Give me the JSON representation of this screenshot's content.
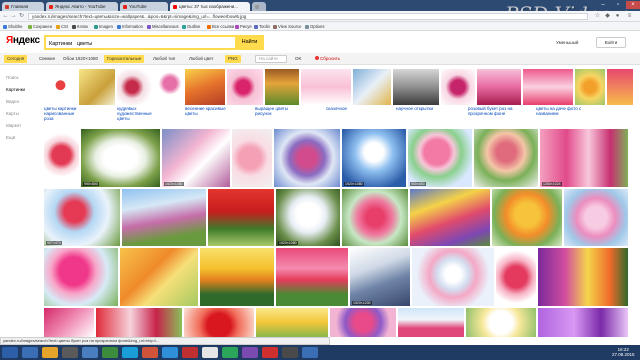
{
  "watermark": "PSD Video.ru",
  "tabs": [
    {
      "label": "Главная",
      "icon": "home-icon",
      "color": "#cf3a2a"
    },
    {
      "label": "Яндекс Авито - YouTube",
      "icon": "youtube-icon",
      "color": "#e62117"
    },
    {
      "label": "YouTube",
      "icon": "youtube-icon",
      "color": "#e62117"
    },
    {
      "label": "цветы: 37 тыс изображени...",
      "icon": "yandex-icon",
      "color": "#f00"
    },
    {
      "label": "",
      "icon": "new-tab-icon",
      "color": "#999"
    }
  ],
  "address": "yandex.ru/images/search?text=цветы&isize=wallpaper&...&pos=6&rpt=simage&img_url=...floweerbowl6.jpg",
  "bookmarks": [
    {
      "label": "Shubhe",
      "color": "#3a7bd5"
    },
    {
      "label": "Сохранен",
      "color": "#7bb341"
    },
    {
      "label": "CSI",
      "color": "#e6a117"
    },
    {
      "label": "Кэпок",
      "color": "#4a4a4a"
    },
    {
      "label": "Imagen",
      "color": "#2a9d8f"
    },
    {
      "label": "Information",
      "color": "#3a7bd5"
    },
    {
      "label": "Miscellaneous",
      "color": "#7e57c2"
    },
    {
      "label": "Outline",
      "color": "#26a69a"
    },
    {
      "label": "Все ссылки",
      "color": "#ef6c00"
    },
    {
      "label": "Рисуя",
      "color": "#ab47bc"
    },
    {
      "label": "Toolin",
      "color": "#5c6bc0"
    },
    {
      "label": "View Source",
      "color": "#8d6e63"
    },
    {
      "label": "Options",
      "color": "#78909c"
    }
  ],
  "logo": {
    "first": "Я",
    "rest": "ндекс"
  },
  "search": {
    "query": "Картинки   цветы",
    "button": "Найти"
  },
  "header_right": {
    "uploaded": "Уменьшый",
    "login": "Войти"
  },
  "filters": [
    {
      "label": "Сегодня",
      "style": "yellow"
    },
    {
      "label": "Свежие",
      "style": "plain"
    },
    {
      "label": "Обои 1920×1080",
      "style": "plain"
    },
    {
      "label": "Горизонтальные",
      "style": "yellow"
    },
    {
      "label": "Любой тип",
      "style": "plain"
    },
    {
      "label": "Любой цвет",
      "style": "plain"
    },
    {
      "label": "PNG",
      "style": "yellow"
    },
    {
      "label": "На сайте",
      "style": "box"
    },
    {
      "label": "OK",
      "style": "plain"
    },
    {
      "label": "Сбросить",
      "style": "plain"
    }
  ],
  "leftnav": [
    "Поиск",
    "Картинки",
    "Видео",
    "Карты",
    "Маркет",
    "Ещё"
  ],
  "related": [
    "цветы картинки нарисованные роза",
    "кудрявых художественные цветы",
    "весенние красивые цветы",
    "выращен цветы рисунок",
    "сказочное",
    "научное открытки",
    "розовый букет роз на прозрачном фоне",
    "цветы на даче фото с названием"
  ],
  "captions": {
    "r1": [
      "",
      "990×800",
      "1920×1080",
      "",
      "",
      "1920×1080",
      "900×650",
      "",
      "1280×1024"
    ],
    "r2": [
      "907×474",
      "",
      "",
      "1920×1080",
      "",
      "",
      "",
      ""
    ],
    "r3": [
      "",
      "",
      "",
      "",
      "1920×1200",
      ""
    ],
    "r4": [
      "",
      "",
      "",
      "",
      "",
      "",
      "",
      ""
    ]
  },
  "status_url": "yandex.ru/images/search?text=цветы букет роз на прозрачном фоне&img_url=http://...",
  "clock": {
    "time": "16:22",
    "date": "27.08.2015"
  },
  "colors": {
    "yandex_yellow": "#ffdb4d",
    "yandex_red": "#ff0000",
    "link_blue": "#0044bb",
    "taskbar": "#1f3a63"
  }
}
